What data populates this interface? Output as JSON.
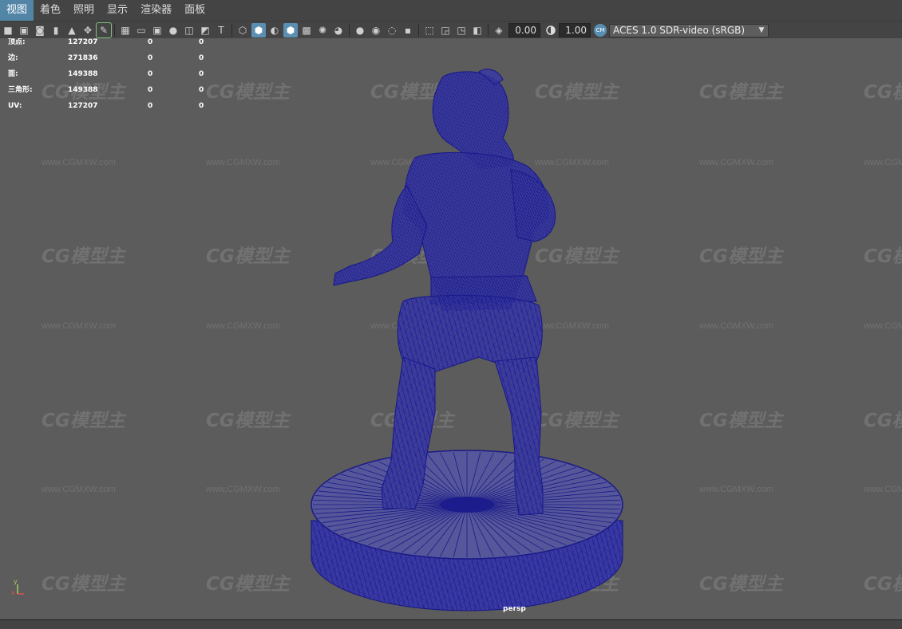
{
  "menu": {
    "items": [
      "视图",
      "着色",
      "照明",
      "显示",
      "渲染器",
      "面板"
    ],
    "active_index": 0
  },
  "toolbar": {
    "buttons": [
      {
        "icon": "camera-icon"
      },
      {
        "icon": "camera-lock-icon"
      },
      {
        "icon": "camera-attributes-icon"
      },
      {
        "icon": "bookmark-icon"
      },
      {
        "icon": "image-plane-icon"
      },
      {
        "icon": "two-d-pan-zoom-icon"
      },
      {
        "icon": "grease-pencil-icon",
        "active": true
      },
      {
        "sep": true
      },
      {
        "icon": "grid-icon"
      },
      {
        "icon": "film-gate-icon"
      },
      {
        "icon": "resolution-gate-icon"
      },
      {
        "icon": "gate-mask-icon"
      },
      {
        "icon": "field-chart-icon"
      },
      {
        "icon": "safe-action-icon"
      },
      {
        "icon": "safe-title-icon"
      },
      {
        "sep": true
      },
      {
        "icon": "wireframe-icon"
      },
      {
        "icon": "smooth-shade-icon",
        "on": true
      },
      {
        "icon": "default-material-icon"
      },
      {
        "icon": "wireframe-on-shaded-icon",
        "on": true
      },
      {
        "icon": "textured-icon"
      },
      {
        "icon": "use-lights-icon"
      },
      {
        "icon": "shadows-icon"
      },
      {
        "sep": true
      },
      {
        "icon": "screen-space-ao-icon"
      },
      {
        "icon": "motion-blur-icon"
      },
      {
        "icon": "anti-aliasing-icon"
      },
      {
        "icon": "depth-of-field-icon"
      },
      {
        "sep": true
      },
      {
        "icon": "isolate-select-icon"
      },
      {
        "icon": "xray-icon"
      },
      {
        "icon": "xray-joints-icon"
      },
      {
        "icon": "backface-culling-icon"
      },
      {
        "sep": true
      },
      {
        "icon": "exposure-icon"
      }
    ],
    "exposure_value": "0.00",
    "gamma_icon": "gamma-icon",
    "gamma_value": "1.00",
    "color_space_icon": "color-management-icon",
    "color_space_icon_text": "CM",
    "color_space": "ACES 1.0 SDR-video (sRGB)",
    "dropdown_icon": "chevron-down-icon"
  },
  "hud": {
    "rows": [
      {
        "label": "顶点:",
        "v1": "127207",
        "v2": "0",
        "v3": "0"
      },
      {
        "label": "边:",
        "v1": "271836",
        "v2": "0",
        "v3": "0"
      },
      {
        "label": "面:",
        "v1": "149388",
        "v2": "0",
        "v3": "0"
      },
      {
        "label": "三角形:",
        "v1": "149388",
        "v2": "0",
        "v3": "0"
      },
      {
        "label": "UV:",
        "v1": "127207",
        "v2": "0",
        "v3": "0"
      }
    ]
  },
  "viewport": {
    "camera_label": "persp",
    "axis_y": "y",
    "axis_x": "x",
    "background_color": "#5c5c5c",
    "wireframe_color": "#1c1c8c"
  },
  "watermark": {
    "logo_text": "CG模型主",
    "url_text": "www.CGMXW.com"
  }
}
